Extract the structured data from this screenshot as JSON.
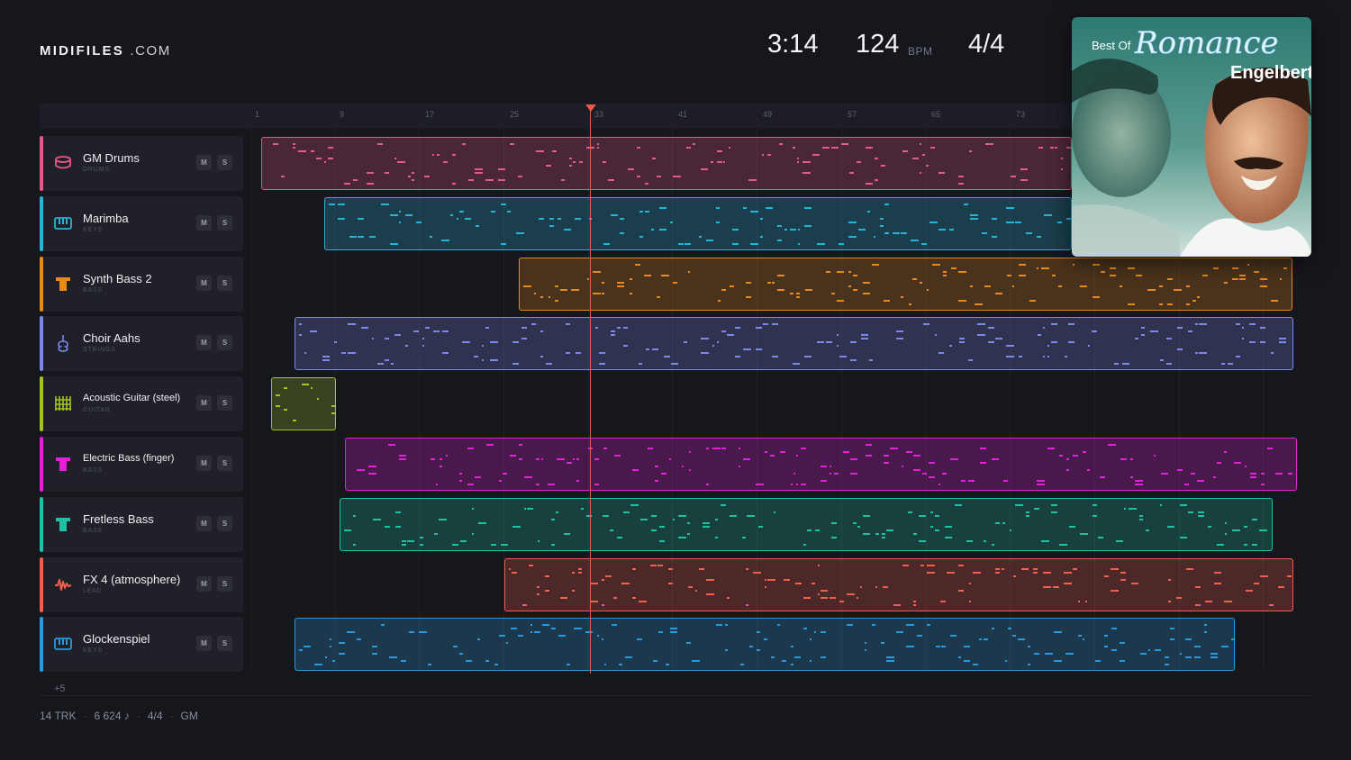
{
  "header": {
    "logo_bold": "MIDIFILES",
    "logo_rest": ".COM",
    "duration": "3:14",
    "tempo": "124",
    "tempo_unit": "BPM",
    "time_signature": "4/4"
  },
  "ruler": {
    "ticks": [
      "1",
      "9",
      "17",
      "25",
      "33",
      "41",
      "49",
      "57",
      "65",
      "73"
    ]
  },
  "tracks": [
    {
      "name": "GM Drums",
      "category": "DRUMS",
      "color": "#e8578a",
      "icon": "drum-icon"
    },
    {
      "name": "Marimba",
      "category": "KEYS",
      "color": "#27b3d6",
      "icon": "keyboard-icon"
    },
    {
      "name": "Synth Bass 2",
      "category": "BASS",
      "color": "#e8891c",
      "icon": "bass-icon"
    },
    {
      "name": "Choir Aahs",
      "category": "STRINGS",
      "color": "#7b88e8",
      "icon": "violin-icon"
    },
    {
      "name": "Acoustic Guitar (steel)",
      "category": "GUITAR",
      "color": "#a2c322",
      "icon": "guitar-fretboard-icon"
    },
    {
      "name": "Electric Bass (finger)",
      "category": "BASS",
      "color": "#e21fd9",
      "icon": "bass-icon"
    },
    {
      "name": "Fretless Bass",
      "category": "BASS",
      "color": "#1fc0a3",
      "icon": "bass-icon"
    },
    {
      "name": "FX 4 (atmosphere)",
      "category": "LEAD",
      "color": "#ef5f4b",
      "icon": "waveform-icon"
    },
    {
      "name": "Glockenspiel",
      "category": "KEYS",
      "color": "#2a9ae0",
      "icon": "keyboard-icon"
    }
  ],
  "track_buttons": {
    "mute": "M",
    "solo": "S"
  },
  "more_tracks": "+5",
  "footer": {
    "tracks": "14 TRK",
    "notes": "6 624 ♪",
    "time_signature": "4/4",
    "standard": "GM"
  },
  "album": {
    "line1": "Best Of",
    "line2": "Romance",
    "artist": "Engelbert"
  }
}
